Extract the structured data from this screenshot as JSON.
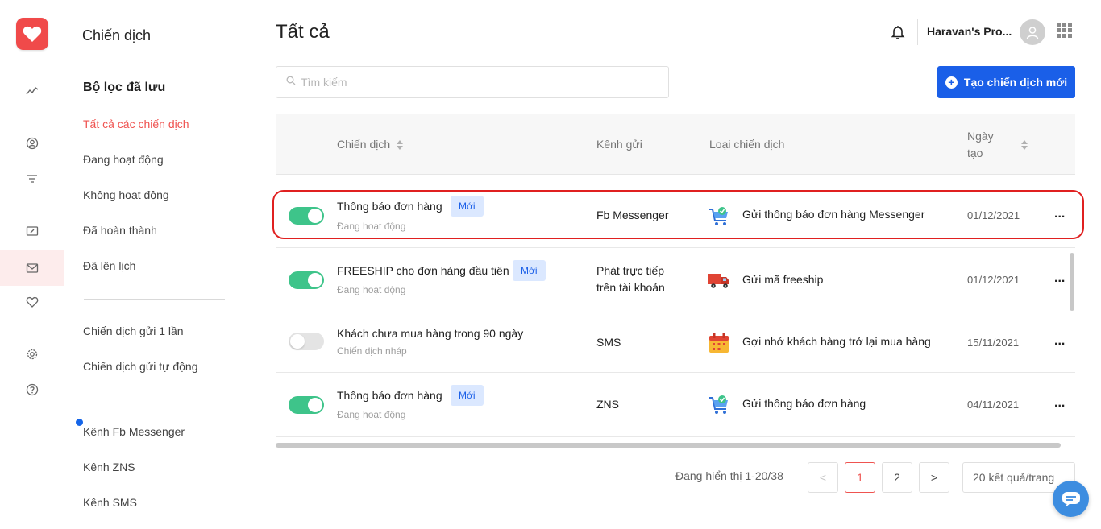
{
  "sidebar": {
    "title": "Chiến dịch",
    "saved_filters_heading": "Bộ lọc đã lưu",
    "filters": [
      "Tất cả các chiến dịch",
      "Đang hoạt động",
      "Không hoạt động",
      "Đã hoàn thành",
      "Đã lên lịch"
    ],
    "send_types": [
      "Chiến dịch gửi 1 lần",
      "Chiến dịch gửi tự động"
    ],
    "channels": [
      "Kênh Fb Messenger",
      "Kênh ZNS",
      "Kênh SMS"
    ]
  },
  "header": {
    "title": "Tất cả",
    "store_name": "Haravan's Pro..."
  },
  "search": {
    "placeholder": "Tìm kiếm"
  },
  "create_button": {
    "label": "Tạo chiến dịch mới"
  },
  "table": {
    "columns": [
      "Chiến dịch",
      "Kênh gửi",
      "Loại chiến dịch",
      "Ngày",
      "tạo"
    ],
    "rows": [
      {
        "name": "Thông báo đơn hàng",
        "badge": "Mới",
        "status": "Đang hoạt động",
        "channel": "Fb Messenger",
        "channel_line2": "",
        "type": "Gửi thông báo đơn hàng Messenger",
        "type_icon": "cart-check-icon",
        "date": "01/12/2021",
        "enabled": true,
        "more": "..."
      },
      {
        "name": "FREESHIP cho đơn hàng đầu tiên",
        "badge": "Mới",
        "status": "Đang hoạt động",
        "channel": "Phát trực tiếp",
        "channel_line2": "trên tài khoản",
        "type": "Gửi mã freeship",
        "type_icon": "truck-icon",
        "date": "01/12/2021",
        "enabled": true,
        "more": "..."
      },
      {
        "name": "Khách chưa mua hàng trong 90 ngày",
        "badge": "",
        "status": "Chiến dịch nháp",
        "channel": "SMS",
        "channel_line2": "",
        "type": "Gợi nhớ khách hàng trở lại mua hàng",
        "type_icon": "calendar-icon",
        "date": "15/11/2021",
        "enabled": false,
        "more": "..."
      },
      {
        "name": "Thông báo đơn hàng",
        "badge": "Mới",
        "status": "Đang hoạt động",
        "channel": "ZNS",
        "channel_line2": "",
        "type": "Gửi thông báo đơn hàng",
        "type_icon": "cart-check-icon",
        "date": "04/11/2021",
        "enabled": true,
        "more": "..."
      }
    ]
  },
  "pagination": {
    "showing": "Đang hiển thị 1-20/38",
    "prev": "<",
    "pages": [
      "1",
      "2"
    ],
    "next": ">",
    "current_page": "1",
    "per_page": "20 kết quả/trang"
  },
  "colors": {
    "accent": "#1a5fe8",
    "brand": "#f04a4a",
    "active_filter": "#ef5350",
    "toggle_on": "#3ec48a",
    "highlight_border": "#e02020"
  }
}
